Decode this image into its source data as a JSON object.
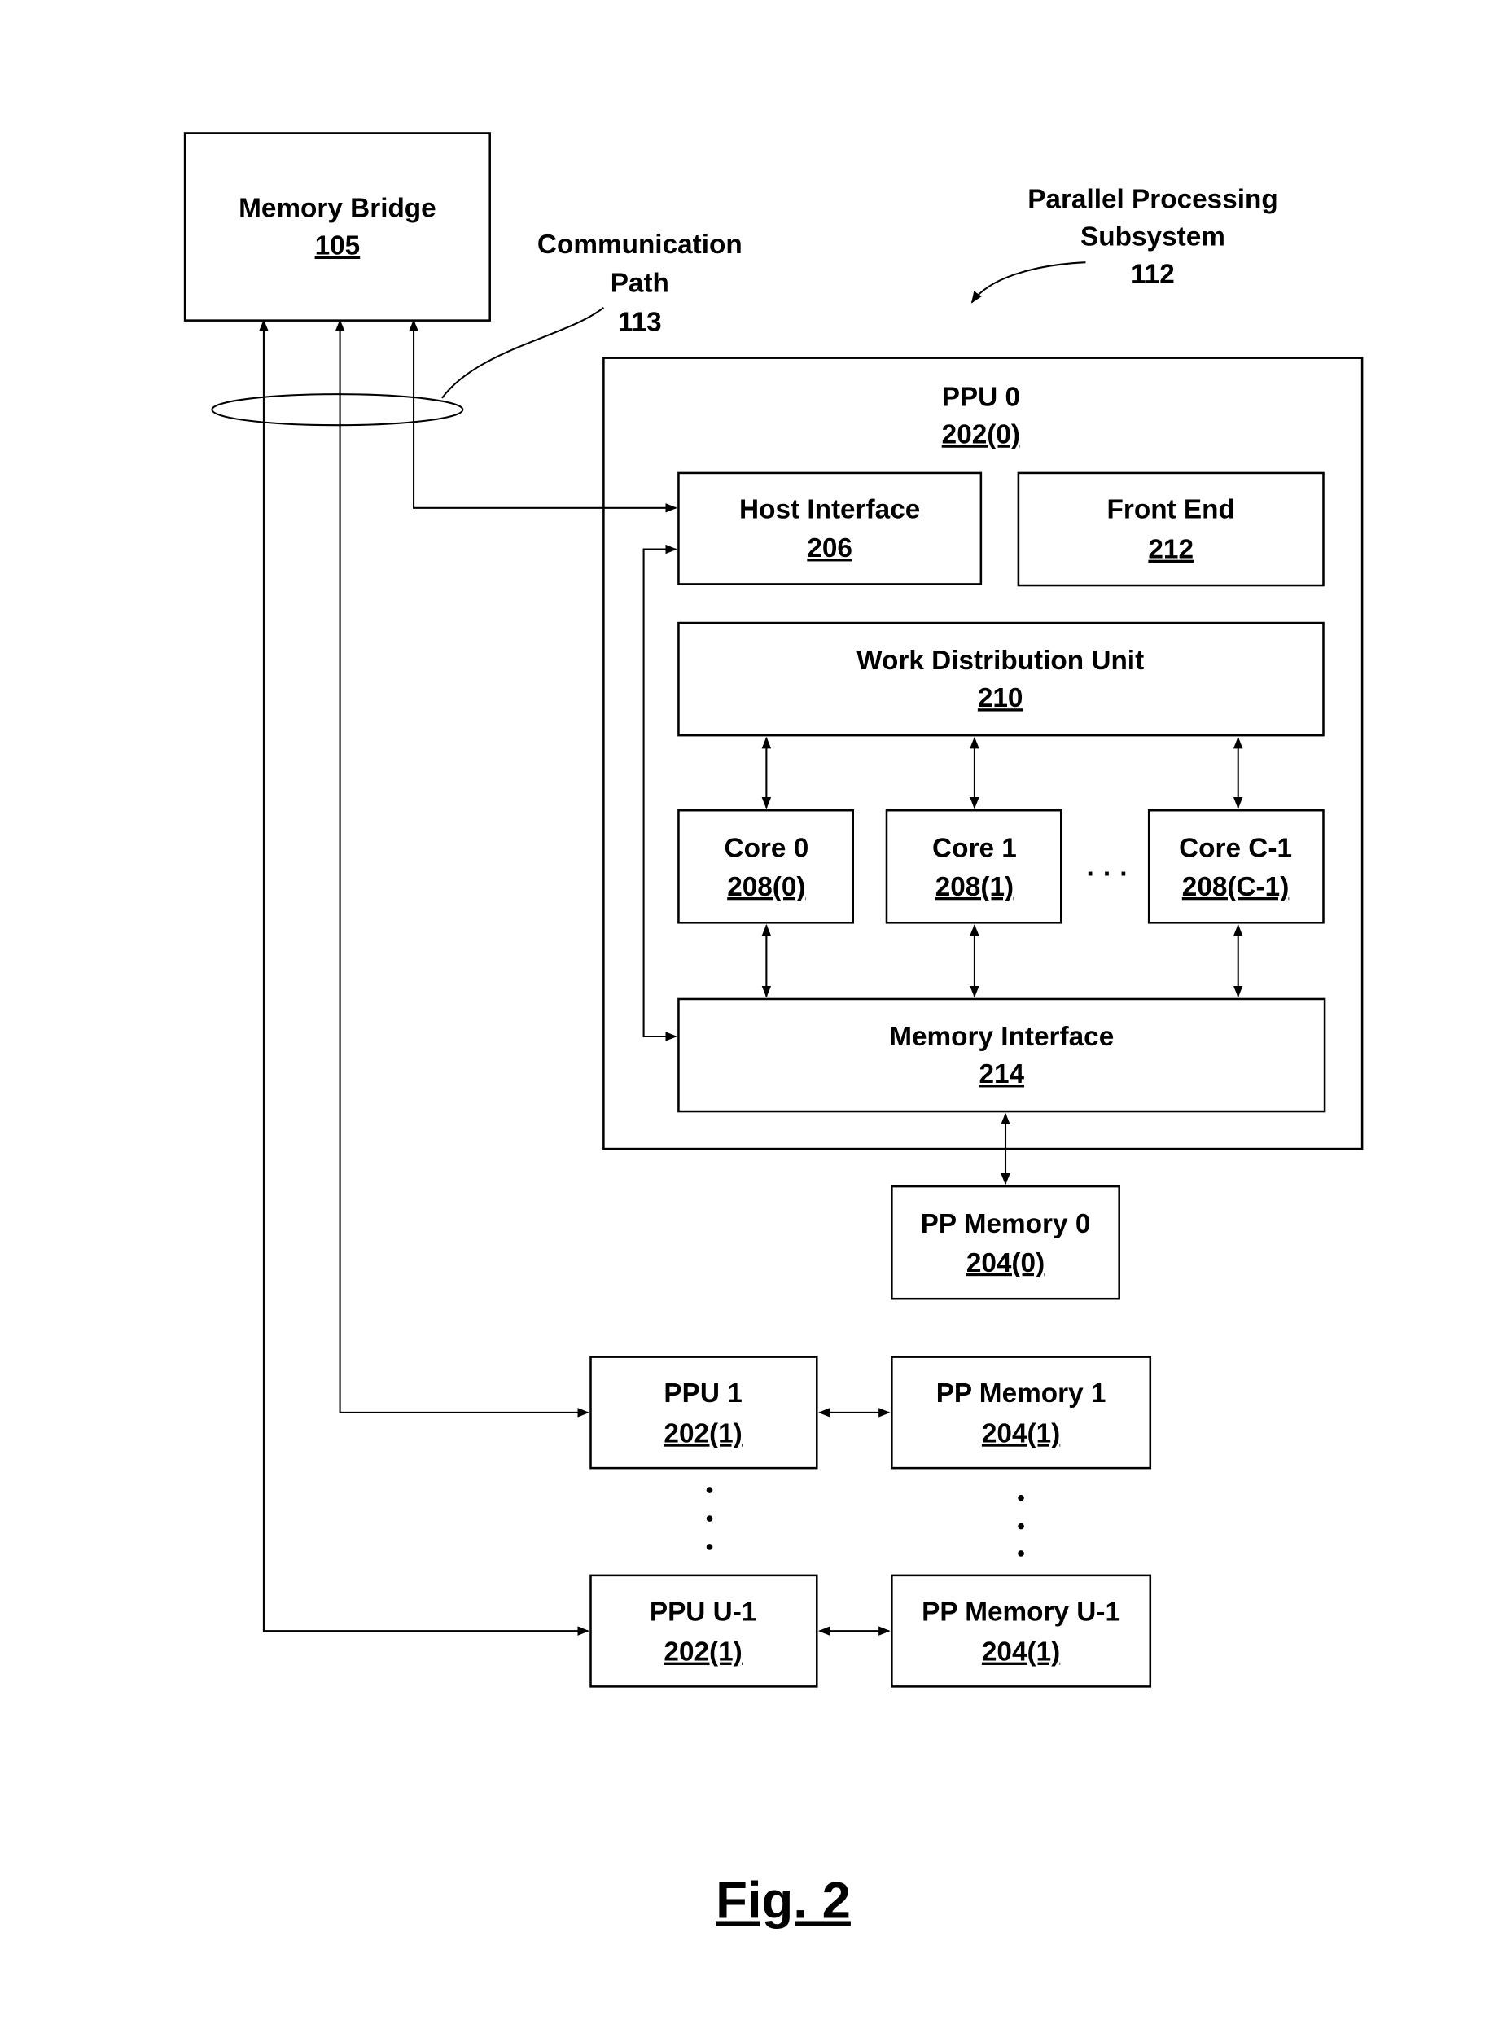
{
  "figure_label": "Fig. 2",
  "callouts": {
    "communication_path": {
      "line1": "Communication",
      "line2": "Path",
      "ref": "113"
    },
    "parallel_processing_subsystem": {
      "line1": "Parallel Processing",
      "line2": "Subsystem",
      "ref": "112"
    }
  },
  "blocks": {
    "memory_bridge": {
      "name": "Memory Bridge",
      "ref": "105"
    },
    "ppu0": {
      "name": "PPU 0",
      "ref": "202(0)"
    },
    "host_interface": {
      "name": "Host Interface",
      "ref": "206"
    },
    "front_end": {
      "name": "Front End",
      "ref": "212"
    },
    "work_distribution_unit": {
      "name": "Work Distribution Unit",
      "ref": "210"
    },
    "core0": {
      "name": "Core 0",
      "ref": "208(0)"
    },
    "core1": {
      "name": "Core 1",
      "ref": "208(1)"
    },
    "core_c1": {
      "name": "Core C-1",
      "ref": "208(C-1)"
    },
    "memory_interface": {
      "name": "Memory Interface",
      "ref": "214"
    },
    "pp_memory0": {
      "name": "PP Memory 0",
      "ref": "204(0)"
    },
    "ppu1": {
      "name": "PPU 1",
      "ref": "202(1)"
    },
    "pp_memory1": {
      "name": "PP Memory 1",
      "ref": "204(1)"
    },
    "ppu_u1": {
      "name": "PPU U-1",
      "ref": "202(1)"
    },
    "pp_memory_u1": {
      "name": "PP Memory U-1",
      "ref": "204(1)"
    }
  },
  "ellipsis": "· · ·"
}
